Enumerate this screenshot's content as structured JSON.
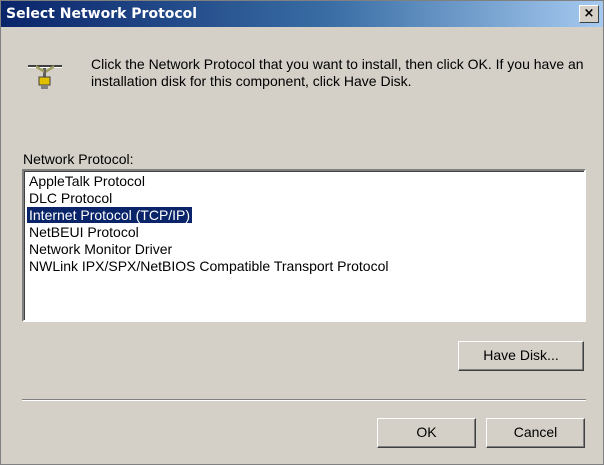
{
  "window": {
    "title": "Select Network Protocol",
    "close_label": "×"
  },
  "description": "Click the Network Protocol that you want to install, then click OK. If you have an installation disk for this component, click Have Disk.",
  "list": {
    "label": "Network Protocol:",
    "items": [
      "AppleTalk Protocol",
      "DLC Protocol",
      "Internet Protocol (TCP/IP)",
      "NetBEUI Protocol",
      "Network Monitor Driver",
      "NWLink IPX/SPX/NetBIOS Compatible Transport Protocol"
    ],
    "selected": "Internet Protocol (TCP/IP)"
  },
  "buttons": {
    "have_disk": "Have Disk...",
    "ok": "OK",
    "cancel": "Cancel"
  },
  "icon": "network-protocol-icon",
  "colors": {
    "titlebar_start": "#0a246a",
    "titlebar_end": "#a6caf0",
    "selection": "#0a246a",
    "dialog_bg": "#d4d0c8"
  }
}
